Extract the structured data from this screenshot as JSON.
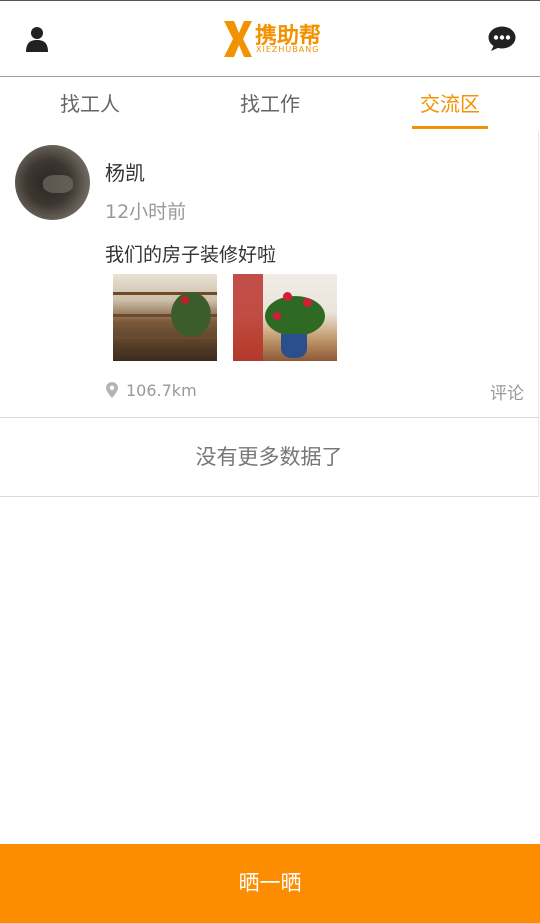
{
  "header": {
    "logo_cn": "携助帮",
    "logo_en": "XIEZHUBANG",
    "user_icon": "user-icon",
    "message_icon": "chat-bubble-icon"
  },
  "tabs": [
    {
      "label": "找工人",
      "active": false
    },
    {
      "label": "找工作",
      "active": false
    },
    {
      "label": "交流区",
      "active": true
    }
  ],
  "post": {
    "username": "杨凯",
    "time": "12小时前",
    "content": "我们的房子装修好啦",
    "distance": "106.7km",
    "comment_label": "评论",
    "location_icon": "map-pin-icon"
  },
  "list_end_text": "没有更多数据了",
  "bottom_button": "晒一晒",
  "colors": {
    "accent": "#f39200",
    "bottom_bar": "#fd8d00"
  }
}
